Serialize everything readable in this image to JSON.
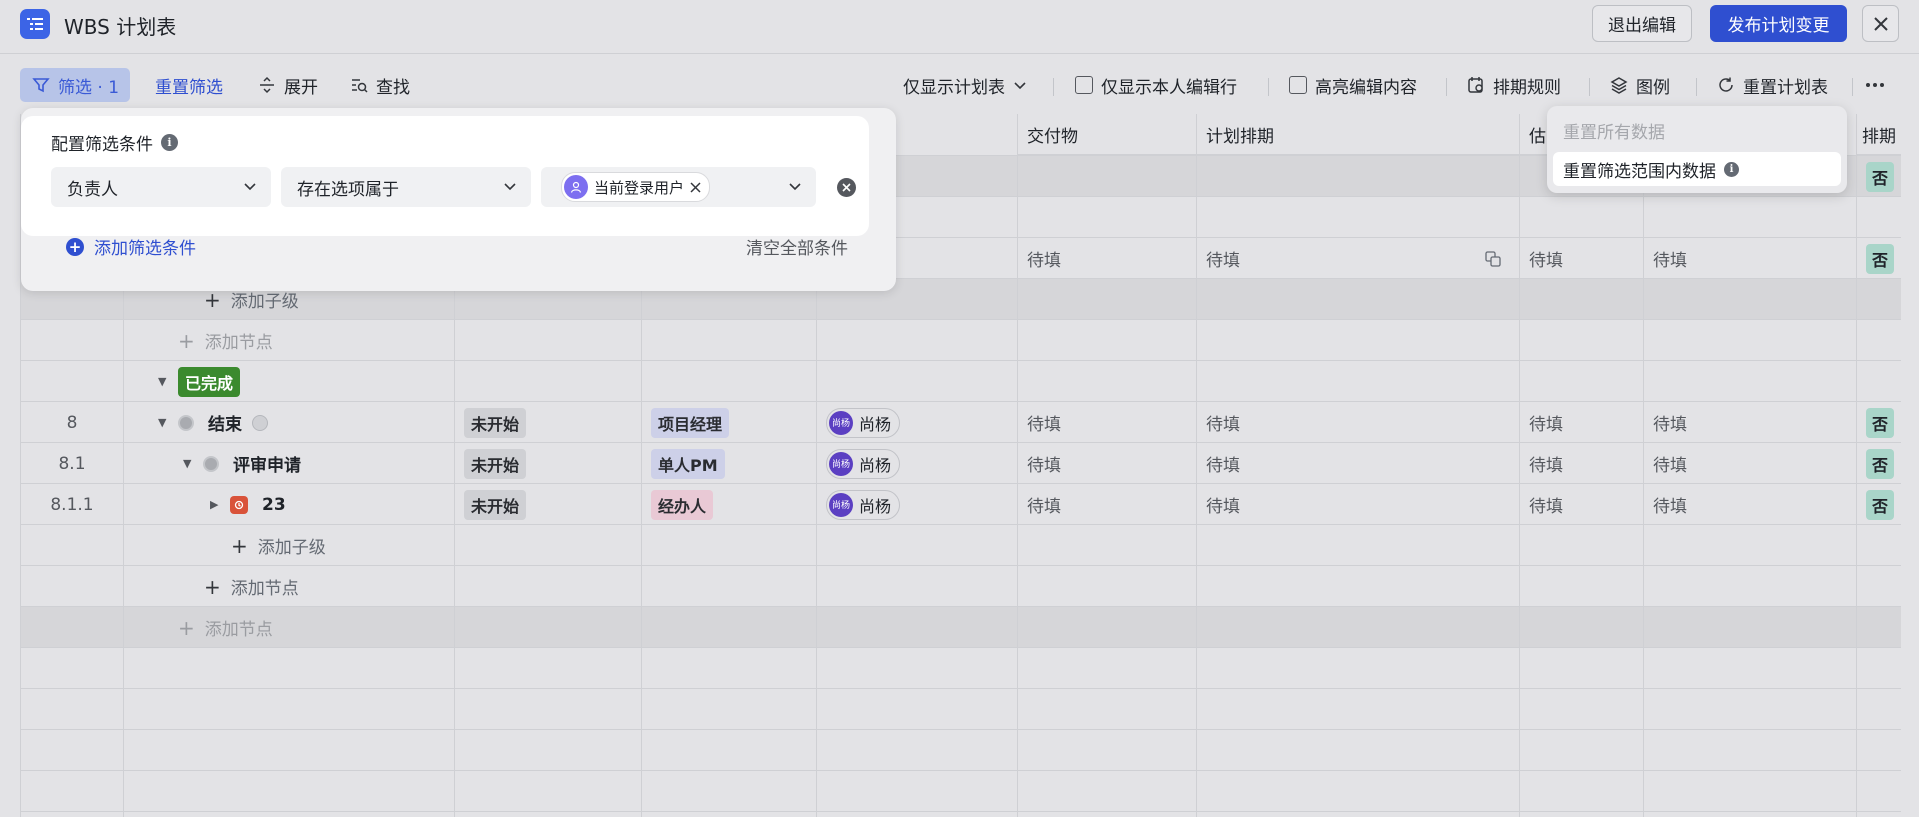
{
  "titlebar": {
    "title": "WBS 计划表",
    "exit_edit": "退出编辑",
    "publish": "发布计划变更"
  },
  "toolbar": {
    "filter": "筛选 · 1",
    "reset_filter": "重置筛选",
    "expand": "展开",
    "find": "查找",
    "only_plan": "仅显示计划表",
    "only_self": "仅显示本人编辑行",
    "highlight": "高亮编辑内容",
    "schedule_rules": "排期规则",
    "legend": "图例",
    "reset_plan": "重置计划表"
  },
  "columns": {
    "deliverable": "交付物",
    "plan_schedule": "计划排期",
    "estimate_partial": "估",
    "scheduled_partial": "排期"
  },
  "placeholder": "待填",
  "rows": {
    "add_child": "添加子级",
    "add_node": "添加节点",
    "done_group": "已完成",
    "no": "否",
    "r8": {
      "num": "8",
      "name": "结束",
      "status": "未开始",
      "role": "项目经理",
      "person": "尚杨"
    },
    "r81": {
      "num": "8.1",
      "name": "评审申请",
      "status": "未开始",
      "role": "单人PM",
      "person": "尚杨"
    },
    "r811": {
      "num": "8.1.1",
      "name": "23",
      "status": "未开始",
      "role": "经办人",
      "person": "尚杨"
    }
  },
  "filter_panel": {
    "title": "配置筛选条件",
    "field": "负责人",
    "operator": "存在选项属于",
    "value": "当前登录用户",
    "add_condition": "添加筛选条件",
    "clear_all": "清空全部条件"
  },
  "reset_menu": {
    "reset_all": "重置所有数据",
    "reset_filtered": "重置筛选范围内数据"
  },
  "colors": {
    "accent": "#2f4fd0",
    "done": "#3b8a2e",
    "no_tag": "#a9d5c9"
  }
}
